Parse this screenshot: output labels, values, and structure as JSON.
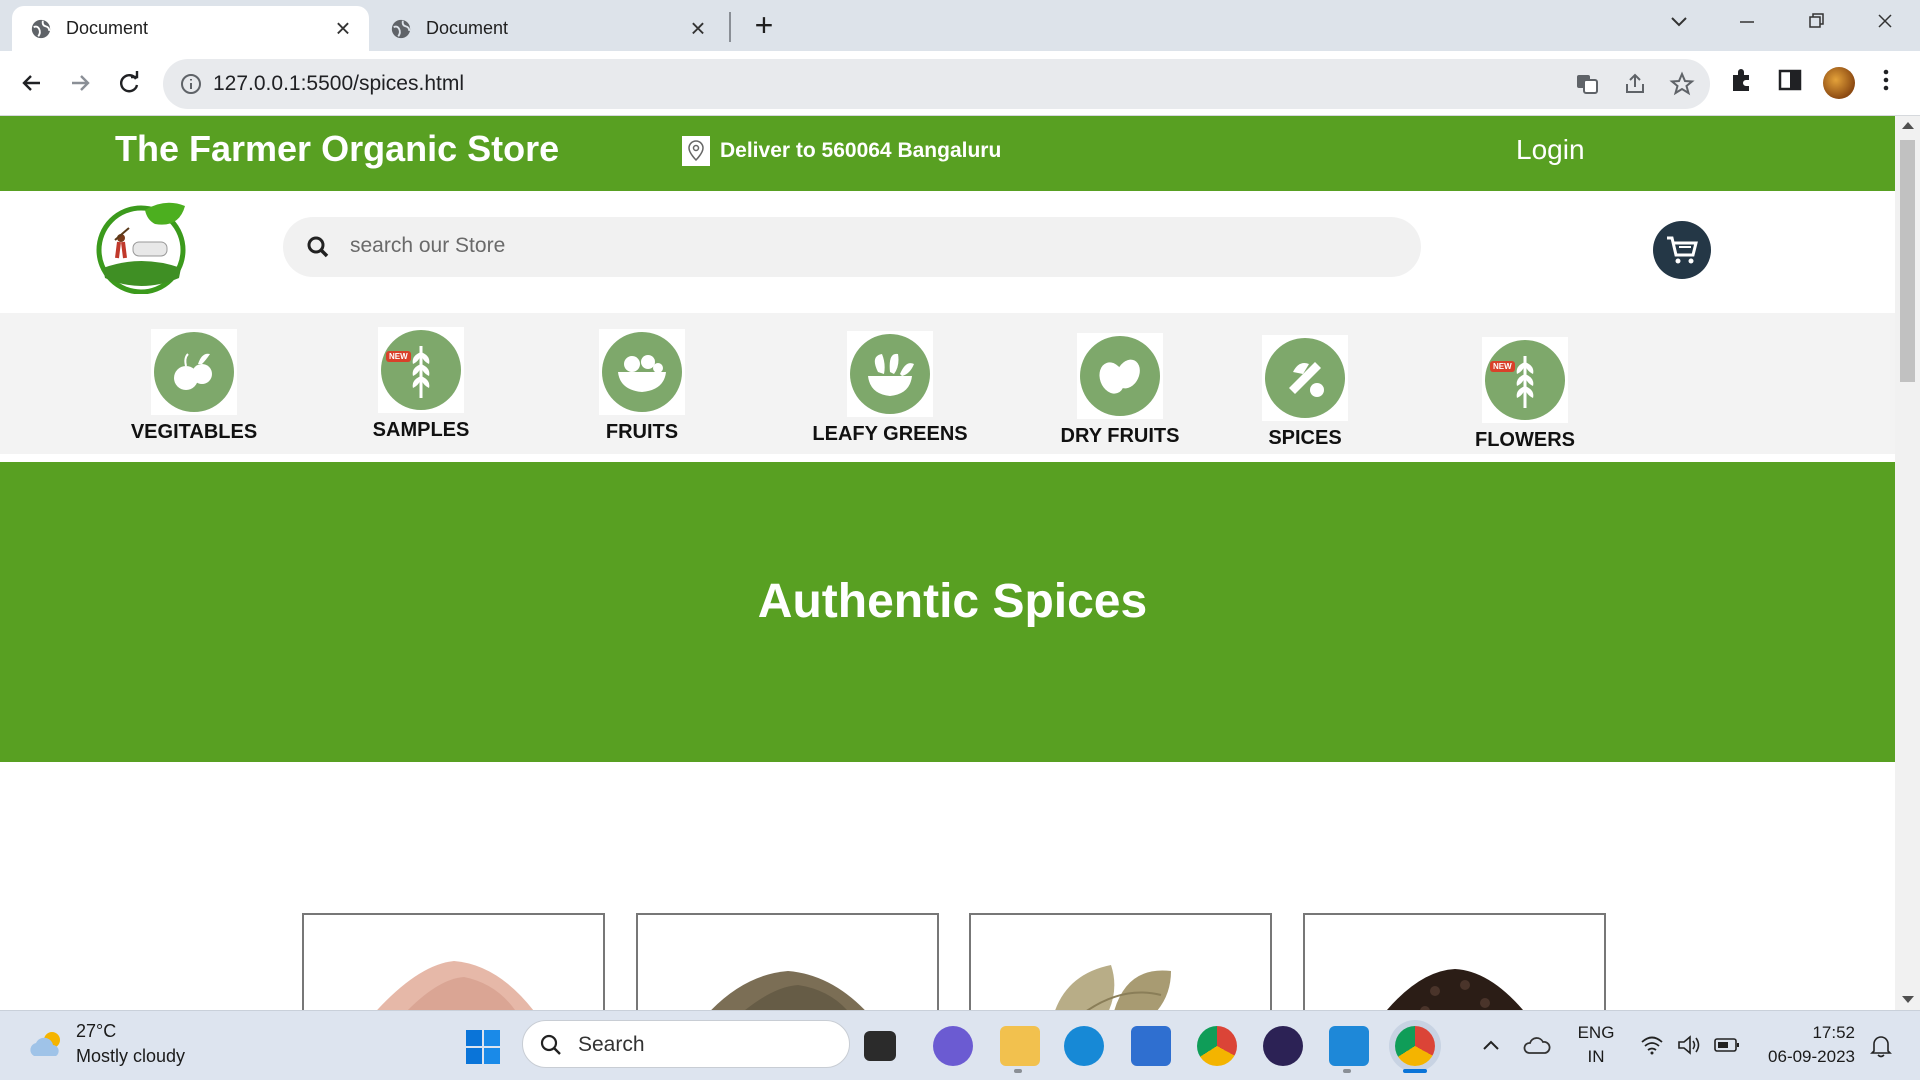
{
  "browser": {
    "tabs": [
      {
        "title": "Document",
        "active": true
      },
      {
        "title": "Document",
        "active": false
      }
    ],
    "url": "127.0.0.1:5500/spices.html"
  },
  "site": {
    "store_name": "The Farmer Organic Store",
    "deliver_text": "Deliver to 560064 Bangaluru",
    "login_label": "Login",
    "search_placeholder": "search our Store",
    "brand_color": "#58a022",
    "categories": [
      {
        "label": "VEGITABLES",
        "icon": "vegetables-icon",
        "new": false
      },
      {
        "label": "SAMPLES",
        "icon": "wheat-icon",
        "new": true
      },
      {
        "label": "FRUITS",
        "icon": "fruit-basket-icon",
        "new": false
      },
      {
        "label": "LEAFY GREENS",
        "icon": "leafy-greens-icon",
        "new": false
      },
      {
        "label": "DRY FRUITS",
        "icon": "almond-icon",
        "new": false
      },
      {
        "label": "SPICES",
        "icon": "spices-icon",
        "new": false
      },
      {
        "label": "FLOWERS",
        "icon": "wheat-icon",
        "new": true
      }
    ],
    "new_badge": "NEW",
    "banner_title": "Authentic Spices",
    "products": [
      {
        "image": "pink-salt-powder"
      },
      {
        "image": "cumin-seeds"
      },
      {
        "image": "bay-leaves"
      },
      {
        "image": "black-pepper"
      }
    ]
  },
  "taskbar": {
    "weather_temp": "27°C",
    "weather_desc": "Mostly cloudy",
    "search_label": "Search",
    "lang_top": "ENG",
    "lang_bottom": "IN",
    "time": "17:52",
    "date": "06-09-2023"
  }
}
